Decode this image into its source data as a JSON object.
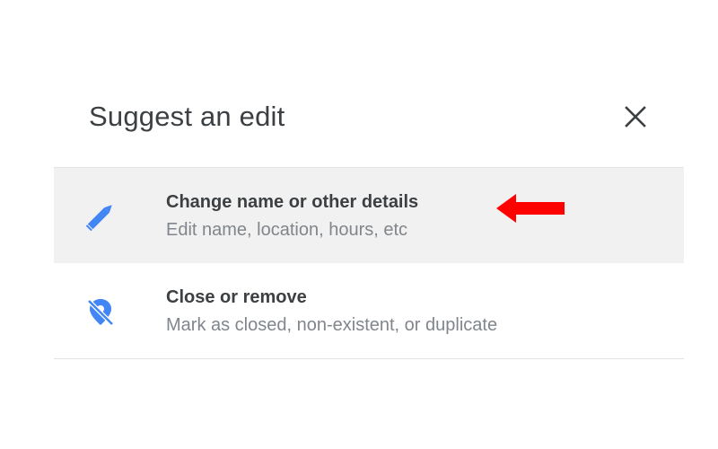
{
  "dialog": {
    "title": "Suggest an edit",
    "close_icon": "close-icon",
    "options": [
      {
        "title": "Change name or other details",
        "description": "Edit name, location, hours, etc",
        "icon": "pencil-icon",
        "icon_color": "#4285f4"
      },
      {
        "title": "Close or remove",
        "description": "Mark as closed, non-existent, or duplicate",
        "icon": "location-off-icon",
        "icon_color": "#4285f4"
      }
    ]
  },
  "annotation": {
    "icon": "red-arrow-icon",
    "color": "#ff0000"
  },
  "colors": {
    "highlight_row": "#f1f1f1",
    "divider": "#e3e3e3",
    "title_text": "#3c4043",
    "secondary_text": "#80868b"
  }
}
